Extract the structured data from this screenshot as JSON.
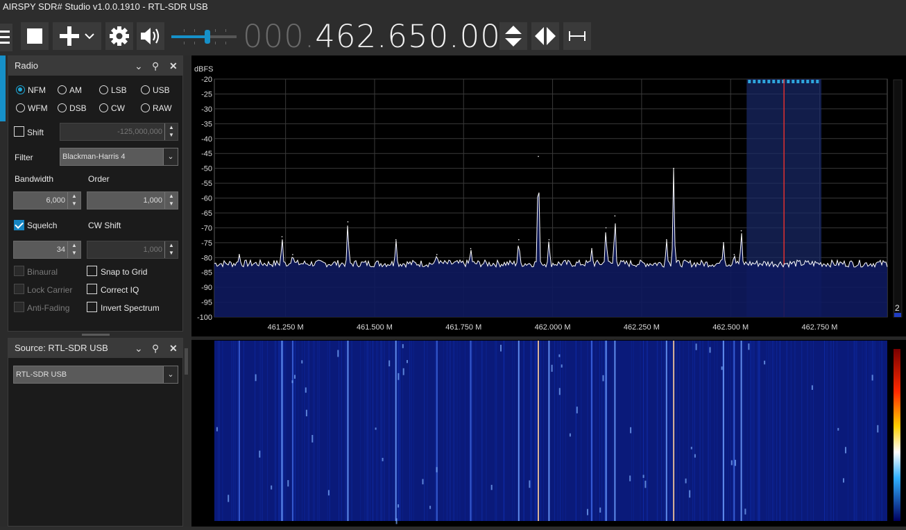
{
  "window": {
    "title": "AIRSPY SDR# Studio v1.0.0.1910 - RTL-SDR USB"
  },
  "toolbar": {
    "frequency_dim": "000.",
    "frequency_lit": "462.650.000",
    "icons": [
      "menu-icon",
      "stop-icon",
      "plus-icon",
      "chevron-down-icon",
      "gear-icon",
      "speaker-icon",
      "volume-slider",
      "arrow-up-down-icon",
      "arrow-left-right-icon",
      "span-icon"
    ]
  },
  "radio_panel": {
    "title": "Radio",
    "modes": [
      {
        "label": "NFM",
        "selected": true
      },
      {
        "label": "AM",
        "selected": false
      },
      {
        "label": "LSB",
        "selected": false
      },
      {
        "label": "USB",
        "selected": false
      },
      {
        "label": "WFM",
        "selected": false
      },
      {
        "label": "DSB",
        "selected": false
      },
      {
        "label": "CW",
        "selected": false
      },
      {
        "label": "RAW",
        "selected": false
      }
    ],
    "shift_label": "Shift",
    "shift_value": "-125,000,000",
    "filter_label": "Filter",
    "filter_value": "Blackman-Harris 4",
    "bandwidth_label": "Bandwidth",
    "bandwidth_value": "6,000",
    "order_label": "Order",
    "order_value": "1,000",
    "squelch_label": "Squelch",
    "squelch_value": "34",
    "cwshift_label": "CW Shift",
    "cwshift_value": "1,000",
    "binaural_label": "Binaural",
    "lock_carrier_label": "Lock Carrier",
    "anti_fading_label": "Anti-Fading",
    "snap_label": "Snap to Grid",
    "correct_iq_label": "Correct IQ",
    "invert_label": "Invert Spectrum"
  },
  "source_panel": {
    "title": "Source: RTL-SDR USB",
    "device": "RTL-SDR USB"
  },
  "spectrum": {
    "ylabel": "dBFS",
    "y_ticks": [
      "-20",
      "-25",
      "-30",
      "-35",
      "-40",
      "-45",
      "-50",
      "-55",
      "-60",
      "-65",
      "-70",
      "-75",
      "-80",
      "-85",
      "-90",
      "-95",
      "-100"
    ],
    "x_ticks": [
      "461.250 M",
      "461.500 M",
      "461.750 M",
      "462.000 M",
      "462.250 M",
      "462.500 M",
      "462.750 M"
    ],
    "zoom_value": "2",
    "colors": {
      "trace": "#ffffff",
      "fill": "#0e1a5e",
      "grid": "#3a3a3a",
      "cursor": "#e03030",
      "filter": "#1a2a6a"
    }
  },
  "chart_data": {
    "type": "line",
    "title": "",
    "xlabel": "",
    "ylabel": "dBFS",
    "xlim": [
      461.05,
      462.94
    ],
    "ylim": [
      -100,
      -20
    ],
    "noise_floor": -82,
    "peaks": [
      {
        "x": 461.12,
        "y": -79
      },
      {
        "x": 461.24,
        "y": -73
      },
      {
        "x": 461.27,
        "y": -79
      },
      {
        "x": 461.425,
        "y": -68
      },
      {
        "x": 461.56,
        "y": -74
      },
      {
        "x": 461.675,
        "y": -79
      },
      {
        "x": 461.77,
        "y": -77
      },
      {
        "x": 461.905,
        "y": -74
      },
      {
        "x": 461.96,
        "y": -46
      },
      {
        "x": 461.99,
        "y": -74
      },
      {
        "x": 462.11,
        "y": -77
      },
      {
        "x": 462.15,
        "y": -70
      },
      {
        "x": 462.175,
        "y": -66
      },
      {
        "x": 462.32,
        "y": -74
      },
      {
        "x": 462.34,
        "y": -50
      },
      {
        "x": 462.48,
        "y": -75
      },
      {
        "x": 462.51,
        "y": -79
      },
      {
        "x": 462.53,
        "y": -71
      }
    ],
    "filter_band": [
      462.545,
      462.755
    ],
    "cursor": 462.65
  }
}
